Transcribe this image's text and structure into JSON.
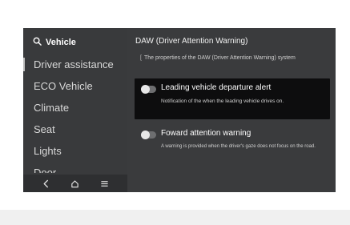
{
  "colors": {
    "screen_bg": "#3a3b3d",
    "highlight_card": "#0d0d0e",
    "toggle_track": "#6d6e70",
    "toggle_knob": "#e7e7e7",
    "text_primary": "#ffffff"
  },
  "sidebar": {
    "header": {
      "icon": "search-icon",
      "label": "Vehicle"
    },
    "items": [
      {
        "label": "Driver assistance",
        "active": true
      },
      {
        "label": "ECO Vehicle"
      },
      {
        "label": "Climate"
      },
      {
        "label": "Seat"
      },
      {
        "label": "Lights"
      },
      {
        "label": "Door"
      }
    ],
    "navbar": [
      {
        "icon": "back-icon"
      },
      {
        "icon": "home-icon"
      },
      {
        "icon": "menu-icon"
      }
    ]
  },
  "main": {
    "title": "DAW (Driver Attention Warning)",
    "description_mark": "[",
    "description": "The properties of the DAW (Driver Attention Warning) system",
    "options": [
      {
        "label": "Leading vehicle departure alert",
        "description": "Notification of the when the leading vehicle drives on.",
        "enabled": false,
        "highlighted": true
      },
      {
        "label": "Foward attention warning",
        "description": "A warning is provided when the driver's gaze does not focus on the road.",
        "enabled": false,
        "highlighted": false
      }
    ]
  }
}
